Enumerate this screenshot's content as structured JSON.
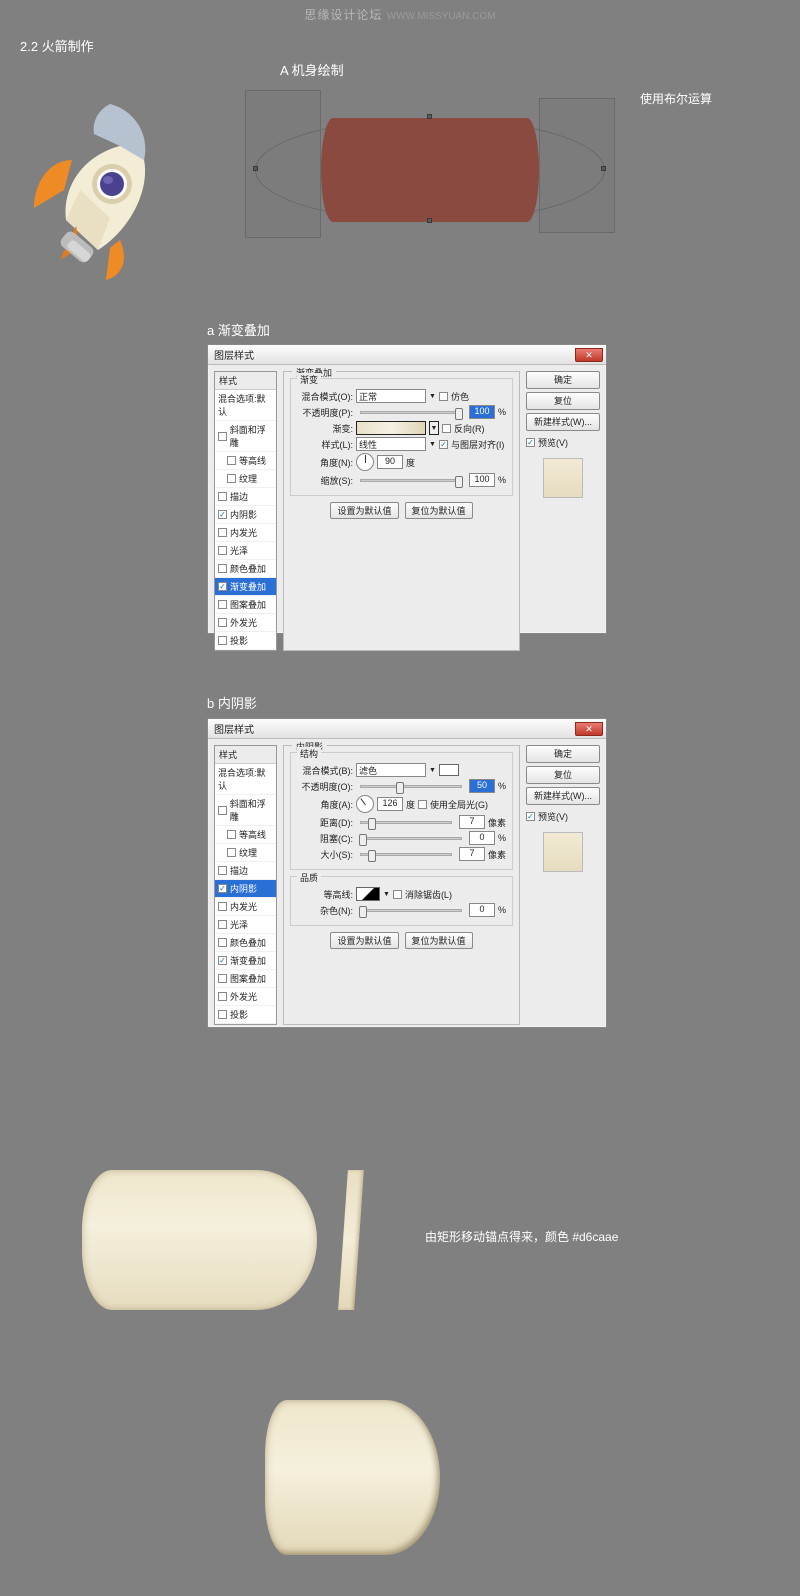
{
  "watermark": {
    "main": "思缘设计论坛",
    "sub": "WWW.MISSYUAN.COM"
  },
  "section": "2.2 火箭制作",
  "labelA": "A 机身绘制",
  "booleanNote": "使用布尔运算",
  "panelA": {
    "title": "a 渐变叠加"
  },
  "panelB": {
    "title": "b 内阴影"
  },
  "dialog": {
    "title": "图层样式",
    "closeGlyph": "✕",
    "styleHeader": "样式",
    "blendDefault": "混合选项:默认",
    "items": {
      "bevelEmboss": "斜面和浮雕",
      "contourSub": "等高线",
      "textureSub": "纹理",
      "stroke": "描边",
      "innerShadow": "内阴影",
      "innerGlow": "内发光",
      "satin": "光泽",
      "colorOverlay": "颜色叠加",
      "gradientOverlay": "渐变叠加",
      "patternOverlay": "图案叠加",
      "outerGlow": "外发光",
      "dropShadow": "投影"
    },
    "side": {
      "ok": "确定",
      "cancel": "复位",
      "newStyle": "新建样式(W)...",
      "preview": "预览(V)"
    },
    "buttons": {
      "makeDefault": "设置为默认值",
      "resetDefault": "复位为默认值"
    }
  },
  "gradient": {
    "group": "渐变叠加",
    "sub": "渐变",
    "blendMode": "混合模式(O):",
    "blendVal": "正常",
    "dither": "仿色",
    "opacity": "不透明度(P):",
    "opacityVal": "100",
    "pct": "%",
    "gradient_lbl": "渐变:",
    "reverse": "反向(R)",
    "style": "样式(L):",
    "styleVal": "线性",
    "alignLayer": "与图层对齐(I)",
    "angle": "角度(N):",
    "angleVal": "90",
    "deg": "度",
    "scale": "缩放(S):",
    "scaleVal": "100"
  },
  "innerShadow": {
    "group": "内阴影",
    "sub": "结构",
    "blendMode": "混合模式(B):",
    "blendVal": "滤色",
    "opacity": "不透明度(O):",
    "opacityVal": "50",
    "pct": "%",
    "angle": "角度(A):",
    "angleVal": "126",
    "deg": "度",
    "globalLight": "使用全局光(G)",
    "distance": "距离(D):",
    "distanceVal": "7",
    "px": "像素",
    "choke": "阻塞(C):",
    "chokeVal": "0",
    "size": "大小(S):",
    "sizeVal": "7",
    "quality": "品质",
    "contour": "等高线:",
    "antialias": "消除锯齿(L)",
    "noise": "杂色(N):",
    "noiseVal": "0"
  },
  "shapeNote": "由矩形移动锚点得来，颜色 #d6caae",
  "chart_data": null
}
